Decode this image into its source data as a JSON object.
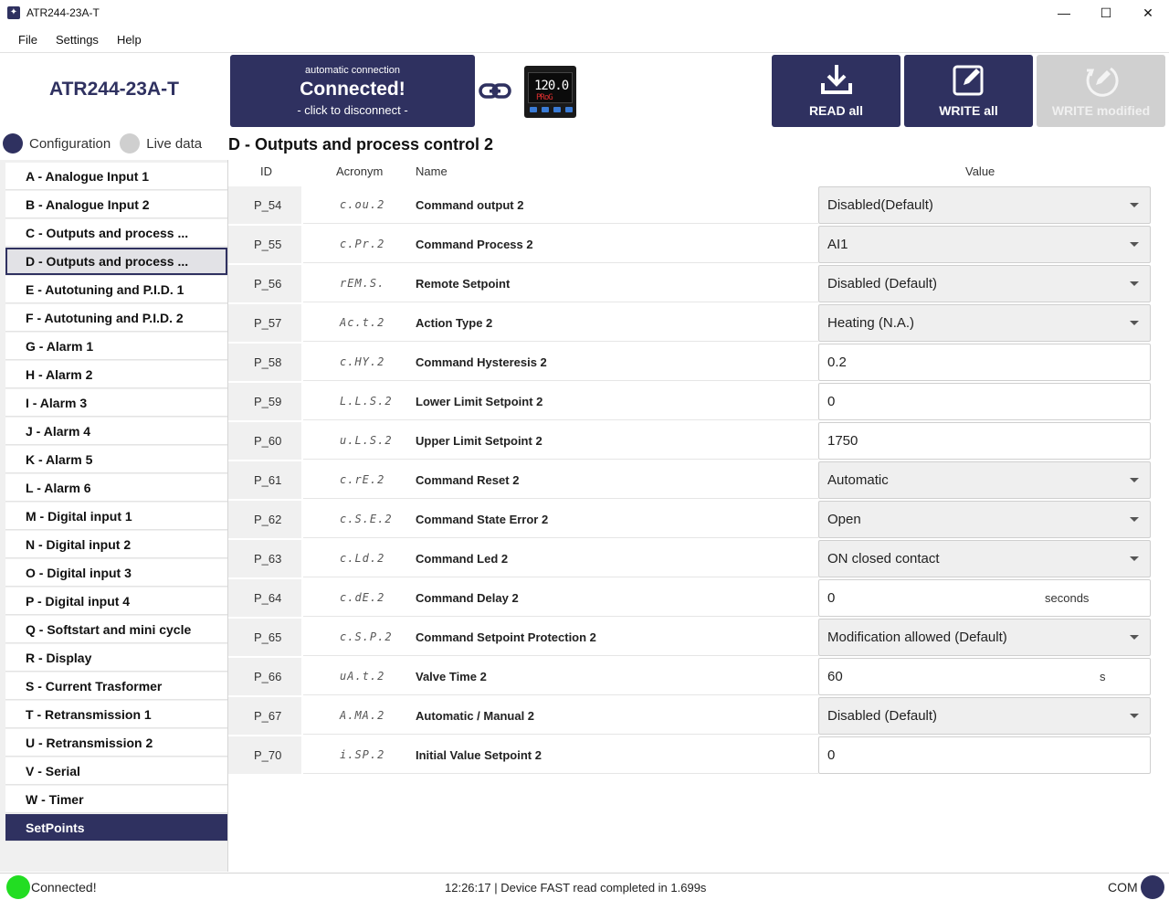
{
  "window": {
    "title": "ATR244-23A-T",
    "minimize": "—",
    "maximize": "☐",
    "close": "✕"
  },
  "menu": [
    "File",
    "Settings",
    "Help"
  ],
  "header": {
    "device_name": "ATR244-23A-T",
    "connection": {
      "top": "automatic connection",
      "main": "Connected!",
      "sub": "- click to disconnect -"
    },
    "device_display": {
      "pv": "120.0",
      "sv": "PRoG"
    },
    "buttons": {
      "read_all": "READ all",
      "write_all": "WRITE all",
      "write_modified": "WRITE modified"
    }
  },
  "toggles": {
    "configuration": "Configuration",
    "live_data": "Live data"
  },
  "section_title": "D - Outputs and process control 2",
  "sidebar": [
    "A - Analogue Input 1",
    "B - Analogue Input 2",
    "C - Outputs and process ...",
    "D - Outputs and process ...",
    "E - Autotuning and P.I.D. 1",
    "F - Autotuning and P.I.D. 2",
    "G - Alarm 1",
    "H - Alarm 2",
    "I - Alarm 3",
    "J - Alarm 4",
    "K - Alarm 5",
    "L - Alarm 6",
    "M - Digital input 1",
    "N - Digital input 2",
    "O - Digital input 3",
    "P - Digital input 4",
    "Q - Softstart and mini cycle",
    "R - Display",
    "S - Current Trasformer",
    "T - Retransmission 1",
    "U - Retransmission 2",
    "V - Serial",
    "W - Timer",
    "SetPoints"
  ],
  "selected_sidebar": 3,
  "table": {
    "headers": {
      "id": "ID",
      "acronym": "Acronym",
      "name": "Name",
      "value": "Value"
    },
    "rows": [
      {
        "id": "P_54",
        "acronym": "c.ou.2",
        "name": "Command output 2",
        "value": "Disabled(Default)",
        "type": "select"
      },
      {
        "id": "P_55",
        "acronym": "c.Pr.2",
        "name": "Command Process 2",
        "value": "AI1",
        "type": "select"
      },
      {
        "id": "P_56",
        "acronym": "rEM.S.",
        "name": "Remote Setpoint",
        "value": "Disabled (Default)",
        "type": "select"
      },
      {
        "id": "P_57",
        "acronym": "Ac.t.2",
        "name": "Action Type 2",
        "value": "Heating (N.A.)",
        "type": "select"
      },
      {
        "id": "P_58",
        "acronym": "c.HY.2",
        "name": "Command Hysteresis 2",
        "value": "0.2",
        "type": "input"
      },
      {
        "id": "P_59",
        "acronym": "L.L.S.2",
        "name": "Lower Limit Setpoint 2",
        "value": "0",
        "type": "input"
      },
      {
        "id": "P_60",
        "acronym": "u.L.S.2",
        "name": "Upper Limit Setpoint 2",
        "value": "1750",
        "type": "input"
      },
      {
        "id": "P_61",
        "acronym": "c.rE.2",
        "name": "Command Reset 2",
        "value": "Automatic",
        "type": "select"
      },
      {
        "id": "P_62",
        "acronym": "c.S.E.2",
        "name": "Command State Error 2",
        "value": "Open",
        "type": "select"
      },
      {
        "id": "P_63",
        "acronym": "c.Ld.2",
        "name": "Command Led 2",
        "value": "ON closed contact",
        "type": "select"
      },
      {
        "id": "P_64",
        "acronym": "c.dE.2",
        "name": "Command Delay 2",
        "value": "0",
        "type": "input",
        "unit": "seconds"
      },
      {
        "id": "P_65",
        "acronym": "c.S.P.2",
        "name": "Command Setpoint Protection 2",
        "value": "Modification allowed (Default)",
        "type": "select"
      },
      {
        "id": "P_66",
        "acronym": "uA.t.2",
        "name": "Valve Time 2",
        "value": "60",
        "type": "input",
        "unit": "s"
      },
      {
        "id": "P_67",
        "acronym": "A.MA.2",
        "name": "Automatic / Manual 2",
        "value": "Disabled (Default)",
        "type": "select"
      },
      {
        "id": "P_70",
        "acronym": "i.SP.2",
        "name": "Initial Value Setpoint 2",
        "value": "0",
        "type": "input"
      }
    ]
  },
  "status": {
    "connected": "Connected!",
    "message": "12:26:17 |   Device FAST read completed in 1.699s",
    "port": "COM"
  },
  "colors": {
    "primary": "#2f3160",
    "status_ok": "#22dd22",
    "disabled": "#d0d0d0"
  }
}
